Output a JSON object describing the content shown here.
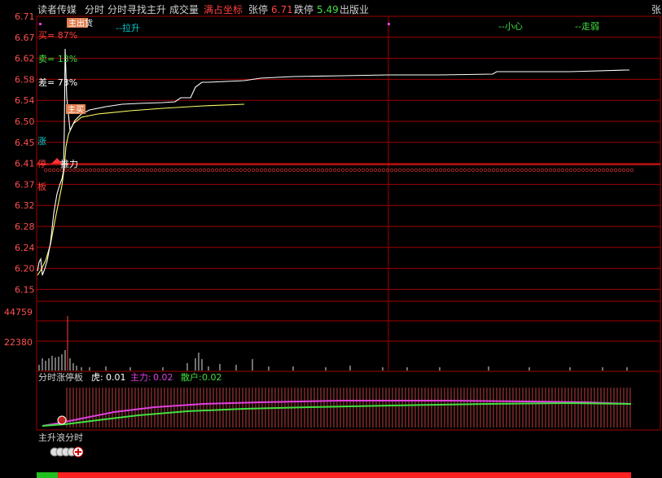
{
  "header": {
    "stock_name": "读者传媒",
    "tab_timeshare": "分时",
    "indicator_name": "分时寻找主升",
    "volume_label": "成交量",
    "fullscale_label": "满占坐标",
    "limit_up_label": "张停",
    "limit_up_value": "6.71",
    "limit_down_label": "跌停",
    "limit_down_value": "5.49",
    "industry": "出版业",
    "right_edge": "张"
  },
  "price_axis": {
    "ticks": [
      "6.71",
      "6.67",
      "6.62",
      "6.58",
      "6.54",
      "6.50",
      "6.45",
      "6.41",
      "6.37",
      "6.32",
      "6.28",
      "6.24",
      "6.20",
      "6.15"
    ]
  },
  "price_panel": {
    "buy_pct": "买= 87%",
    "sell_pct": "卖= 13%",
    "diff_pct": "差= 73%",
    "tag_zhu_chu": "主出货",
    "tag_zhu_mai": "主买",
    "label_la_sheng": "--拉升",
    "label_xiao_xin": "--小心",
    "label_zou_ruo": "--走弱",
    "side_zhang": "涨",
    "side_ting": "停",
    "side_ban": "板",
    "push_label": "推力"
  },
  "volume_axis": {
    "ticks": [
      "44759",
      "22380"
    ]
  },
  "indicator_panel": {
    "title": "分时涨停板",
    "tiger_label": "虎:",
    "tiger_value": "0.01",
    "main_label": "主力:",
    "main_value": "0.02",
    "retail_label": "散户:",
    "retail_value": "0.02"
  },
  "bottom_panel": {
    "title": "主升浪分时"
  },
  "colors": {
    "grid": "#a00000",
    "price_line": "#ffffff",
    "avg_line": "#ffff66",
    "axis_text": "#ff5050",
    "cyan": "#00d0d0",
    "green": "#40e040",
    "magenta": "#e040e0"
  }
}
